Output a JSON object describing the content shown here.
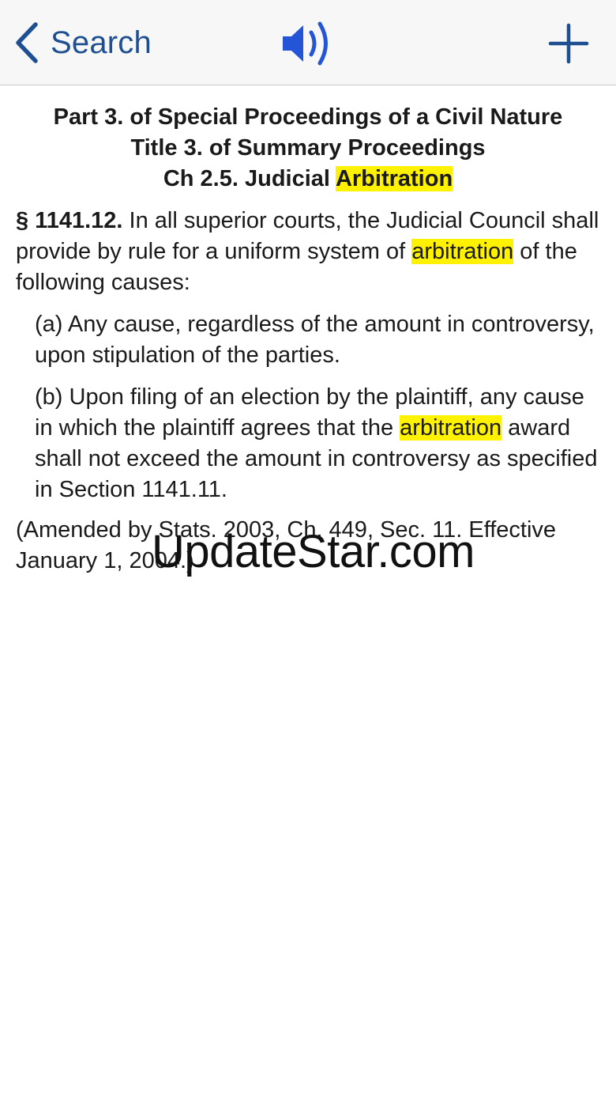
{
  "nav": {
    "back_label": "Search",
    "back_icon": "chevron-left-icon",
    "speaker_icon": "speaker-icon",
    "add_icon": "plus-icon",
    "accent_color": "#1d4f91",
    "speaker_color": "#2355d6"
  },
  "heading": {
    "part": "Part 3. of Special Proceedings of a Civil Nature",
    "title": "Title 3. of Summary Proceedings",
    "chapter_prefix": "Ch 2.5. Judicial ",
    "chapter_highlight": "Arbitration"
  },
  "highlight_color": "#fff200",
  "section": {
    "number": "§ 1141.12.",
    "text_before": " In all superior courts, the Judicial Council shall provide by rule for a uniform system of ",
    "highlight": "arbitration",
    "text_after": " of the following causes:"
  },
  "subparagraphs": {
    "a": {
      "text": "(a) Any cause, regardless of the amount in controversy, upon stipulation of the parties."
    },
    "b": {
      "text_before": "(b) Upon filing of an election by the plaintiff, any cause in which the plaintiff agrees that the ",
      "highlight": "arbitration",
      "text_after": " award shall not exceed the amount in controversy as specified in Section 1141.11."
    }
  },
  "history": "(Amended by Stats. 2003, Ch. 449, Sec. 11. Effective January 1, 2004.)",
  "watermark": "UpdateStar.com"
}
